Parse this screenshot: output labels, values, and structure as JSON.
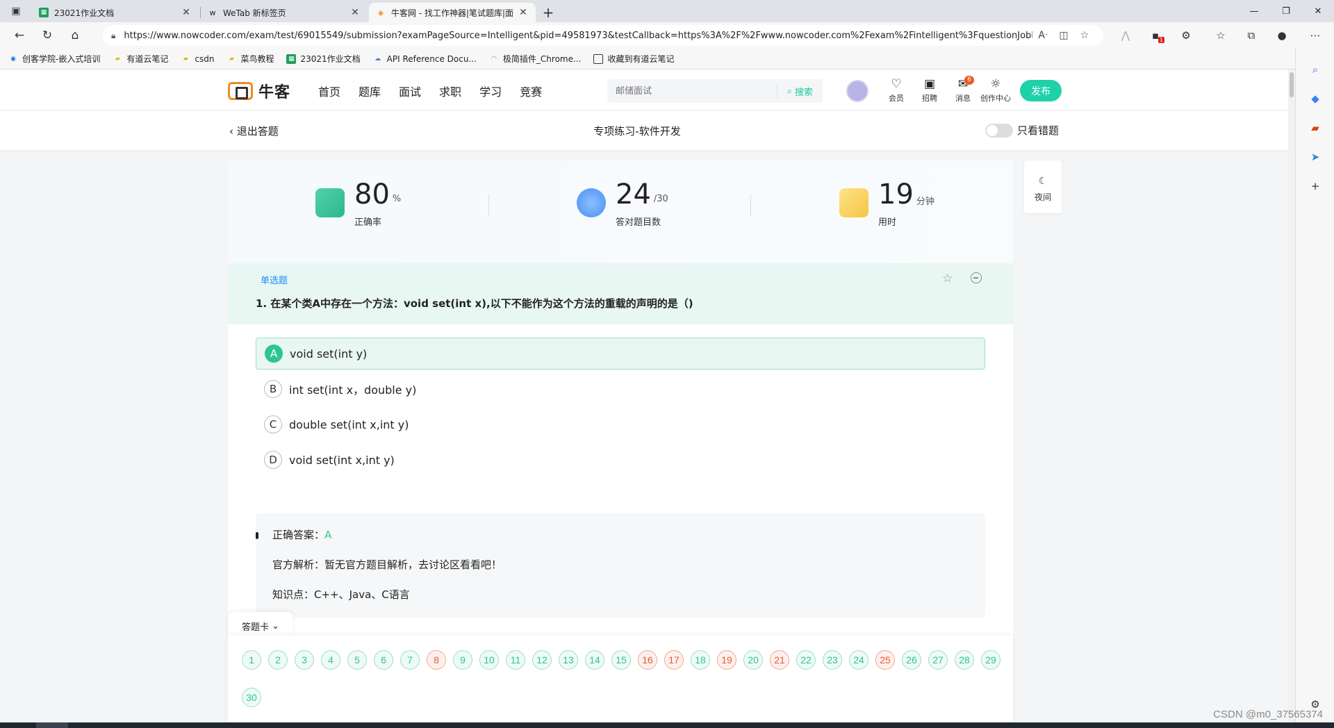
{
  "browser": {
    "tabs": [
      {
        "title": "23021作业文档",
        "icon": "sheets-icon"
      },
      {
        "title": "WeTab 新标签页",
        "icon": "wetab-icon"
      },
      {
        "title": "牛客网 - 找工作神器|笔试题库|面",
        "icon": "nowcoder-icon",
        "active": true
      }
    ],
    "url": "https://www.nowcoder.com/exam/test/69015549/submission?examPageSource=Intelligent&pid=49581973&testCallback=https%3A%2F%2Fwww.nowcoder.com%2Fexam%2Fintelligent%3FquestionJobId%3...",
    "bookmarks": [
      {
        "label": "创客学院-嵌入式培训",
        "icon": "site-icon"
      },
      {
        "label": "有道云笔记",
        "icon": "folder-icon"
      },
      {
        "label": "csdn",
        "icon": "folder-icon"
      },
      {
        "label": "菜鸟教程",
        "icon": "folder-icon"
      },
      {
        "label": "23021作业文档",
        "icon": "sheets-icon"
      },
      {
        "label": "API Reference Docu...",
        "icon": "cloud-icon"
      },
      {
        "label": "极简插件_Chrome...",
        "icon": "rainbow-icon"
      },
      {
        "label": "收藏到有道云笔记",
        "icon": "page-icon"
      }
    ],
    "extension_badge": "1"
  },
  "site": {
    "logo_text": "牛客",
    "nav": [
      "首页",
      "题库",
      "面试",
      "求职",
      "学习",
      "竞赛"
    ],
    "search_placeholder": "邮储面试",
    "search_button": "搜索",
    "header_icons": [
      {
        "label": "会员",
        "icon": "vip-icon"
      },
      {
        "label": "招聘",
        "icon": "recruit-icon"
      },
      {
        "label": "消息",
        "icon": "message-icon",
        "badge": "6"
      },
      {
        "label": "创作中心",
        "icon": "bulb-icon"
      }
    ],
    "publish": "发布"
  },
  "exam": {
    "exit": "退出答题",
    "title": "专项练习-软件开发",
    "toggle_label": "只看错题",
    "night_label": "夜间",
    "stats": [
      {
        "value": "80",
        "unit": "%",
        "label": "正确率",
        "icon": "check-card-icon"
      },
      {
        "value": "24",
        "unit": "/30",
        "label": "答对题目数",
        "icon": "award-icon"
      },
      {
        "value": "19",
        "unit": "分钟",
        "label": "用时",
        "icon": "clock-card-icon"
      }
    ],
    "question": {
      "type": "单选题",
      "text": "1. 在某个类A中存在一个方法：void set(int x),以下不能作为这个方法的重载的声明的是（)",
      "options": [
        {
          "letter": "A",
          "text": "void set(int y)",
          "selected": true
        },
        {
          "letter": "B",
          "text": "int set(int x，double y)"
        },
        {
          "letter": "C",
          "text": "double set(int x,int y)"
        },
        {
          "letter": "D",
          "text": "void set(int x,int y)"
        }
      ],
      "answer_label": "正确答案：",
      "answer": "A",
      "analysis": "官方解析：暂无官方题目解析，去讨论区看看吧！",
      "knowledge": "知识点：C++、Java、C语言"
    },
    "answer_card": {
      "label": "答题卡",
      "numbers": [
        "1",
        "2",
        "3",
        "4",
        "5",
        "6",
        "7",
        "8",
        "9",
        "10",
        "11",
        "12",
        "13",
        "14",
        "15",
        "16",
        "17",
        "18",
        "19",
        "20",
        "21",
        "22",
        "23",
        "24",
        "25",
        "26",
        "27",
        "28",
        "29",
        "30"
      ],
      "wrong": [
        "8",
        "16",
        "17",
        "19",
        "21",
        "25"
      ]
    }
  },
  "watermark": "CSDN @m0_37565374"
}
